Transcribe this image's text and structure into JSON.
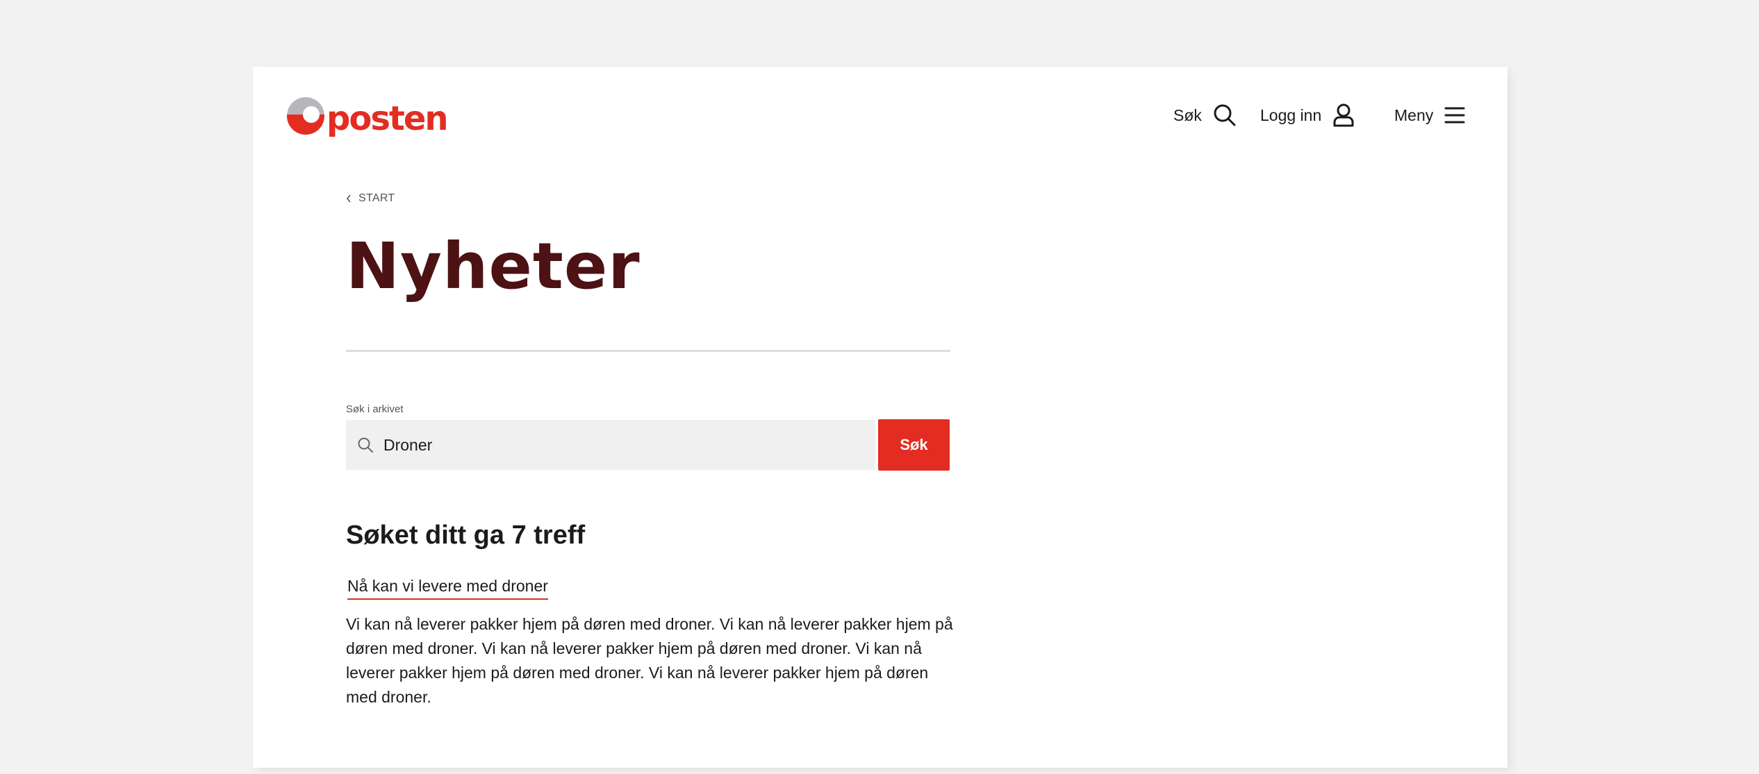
{
  "header": {
    "logo_text": "posten",
    "search_label": "Søk",
    "login_label": "Logg inn",
    "menu_label": "Meny"
  },
  "breadcrumb": {
    "label": "START"
  },
  "page": {
    "title": "Nyheter"
  },
  "search": {
    "label": "Søk i arkivet",
    "value": "Droner",
    "button_label": "Søk"
  },
  "results": {
    "heading": "Søket ditt ga 7 treff",
    "items": [
      {
        "title": "Nå kan vi levere med droner",
        "excerpt": "Vi kan nå leverer pakker hjem på døren med droner. Vi kan nå leverer pakker hjem på døren med droner. Vi kan nå leverer pakker hjem på døren med droner. Vi kan nå leverer pakker hjem på døren med droner. Vi kan nå leverer pakker hjem på døren med droner."
      }
    ]
  },
  "colors": {
    "brand_red": "#e32d22",
    "title_dark_red": "#4d1214",
    "logo_grey": "#b6b6bb"
  },
  "icons": [
    "posten-logo-icon",
    "search-icon",
    "user-icon",
    "hamburger-icon",
    "chevron-left-icon"
  ]
}
